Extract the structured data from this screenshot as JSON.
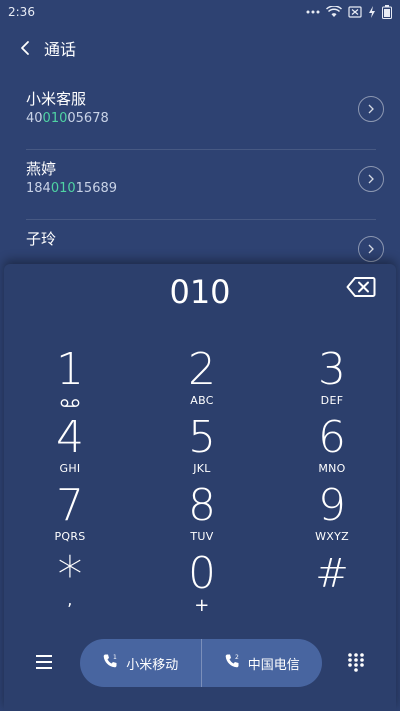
{
  "status": {
    "time": "2:36"
  },
  "header": {
    "title": "通话"
  },
  "contacts": [
    {
      "name": "小米客服",
      "number_pre": "40",
      "number_match": "010",
      "number_post": "05678"
    },
    {
      "name": "燕婷",
      "number_pre": "184",
      "number_match": "010",
      "number_post": "15689"
    },
    {
      "name": "子玲",
      "number_pre": "",
      "number_match": "",
      "number_post": ""
    }
  ],
  "dialer": {
    "display": "010",
    "keys": [
      {
        "digit": "1",
        "letters": ""
      },
      {
        "digit": "2",
        "letters": "ABC"
      },
      {
        "digit": "3",
        "letters": "DEF"
      },
      {
        "digit": "4",
        "letters": "GHI"
      },
      {
        "digit": "5",
        "letters": "JKL"
      },
      {
        "digit": "6",
        "letters": "MNO"
      },
      {
        "digit": "7",
        "letters": "PQRS"
      },
      {
        "digit": "8",
        "letters": "TUV"
      },
      {
        "digit": "9",
        "letters": "WXYZ"
      },
      {
        "digit": "*",
        "letters": ","
      },
      {
        "digit": "0",
        "letters": "+"
      },
      {
        "digit": "#",
        "letters": ""
      }
    ]
  },
  "bottom": {
    "sim1_label": "小米移动",
    "sim2_label": "中国电信"
  },
  "colors": {
    "background": "#2e4272",
    "match_highlight": "#4fd3a3",
    "call_pill": "#4865a0"
  }
}
